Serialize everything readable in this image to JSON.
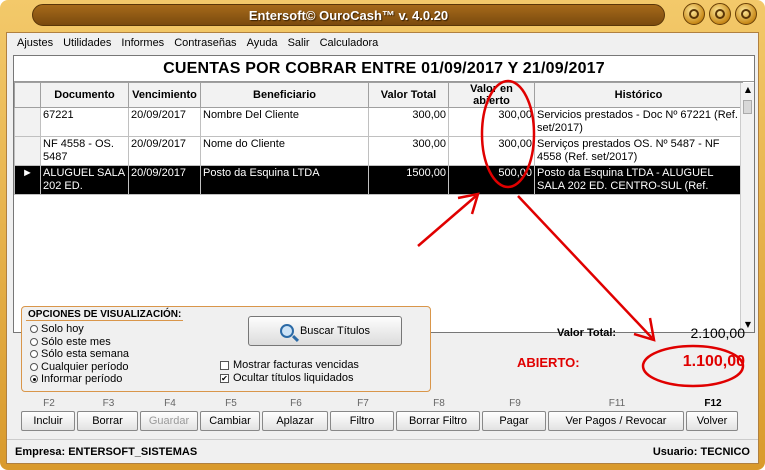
{
  "window": {
    "title": "Entersoft© OuroCash™ v. 4.0.20"
  },
  "menu": {
    "items": [
      "Ajustes",
      "Utilidades",
      "Informes",
      "Contraseñas",
      "Ayuda",
      "Salir",
      "Calculadora"
    ]
  },
  "grid": {
    "title": "CUENTAS POR COBRAR ENTRE 01/09/2017 Y 21/09/2017",
    "columns": [
      "Documento",
      "Vencimiento",
      "Beneficiario",
      "Valor Total",
      "Valor en abierto",
      "Histórico"
    ],
    "rows": [
      {
        "documento": "67221",
        "vencimiento": "20/09/2017",
        "beneficiario": "Nombre Del Cliente",
        "valor_total": "300,00",
        "valor_abierto": "300,00",
        "historico": "Servicios prestados - Doc Nº 67221 (Ref. set/2017)"
      },
      {
        "documento": "NF 4558 - OS. 5487",
        "vencimiento": "20/09/2017",
        "beneficiario": "Nome do Cliente",
        "valor_total": "300,00",
        "valor_abierto": "300,00",
        "historico": "Serviços prestados OS. Nº 5487 - NF 4558 (Ref. set/2017)"
      },
      {
        "documento": "ALUGUEL SALA 202 ED.",
        "vencimiento": "20/09/2017",
        "beneficiario": "Posto da Esquina LTDA",
        "valor_total": "1500,00",
        "valor_abierto": "500,00",
        "historico": "Posto da Esquina LTDA - ALUGUEL SALA 202 ED. CENTRO-SUL (Ref.",
        "selected": true
      }
    ]
  },
  "options": {
    "legend": "OPCIONES DE VISUALIZACIÓN:",
    "radios": [
      "Solo hoy",
      "Sólo este mes",
      "Sólo esta semana",
      "Cualquier período",
      "Informar período"
    ],
    "selected_radio": 4,
    "search_button": "Buscar Títulos",
    "checks": [
      {
        "label": "Mostrar facturas vencidas",
        "checked": false
      },
      {
        "label": "Ocultar títulos liquidados",
        "checked": true
      }
    ]
  },
  "totals": {
    "total_label": "Valor Total:",
    "total_value": "2.100,00",
    "open_label": "ABIERTO:",
    "open_value": "1.100,00"
  },
  "fkeys": [
    "F2",
    "F3",
    "F4",
    "F5",
    "F6",
    "F7",
    "F8",
    "F9",
    "F11",
    "F12"
  ],
  "buttons": [
    "Incluir",
    "Borrar",
    "Guardar",
    "Cambiar",
    "Aplazar",
    "Filtro",
    "Borrar Filtro",
    "Pagar",
    "Ver Pagos / Revocar",
    "Volver"
  ],
  "status": {
    "empresa": "Empresa: ENTERSOFT_SISTEMAS",
    "usuario": "Usuario: TECNICO"
  },
  "colors": {
    "accent": "#d99a2c",
    "annotation": "#e00000"
  }
}
